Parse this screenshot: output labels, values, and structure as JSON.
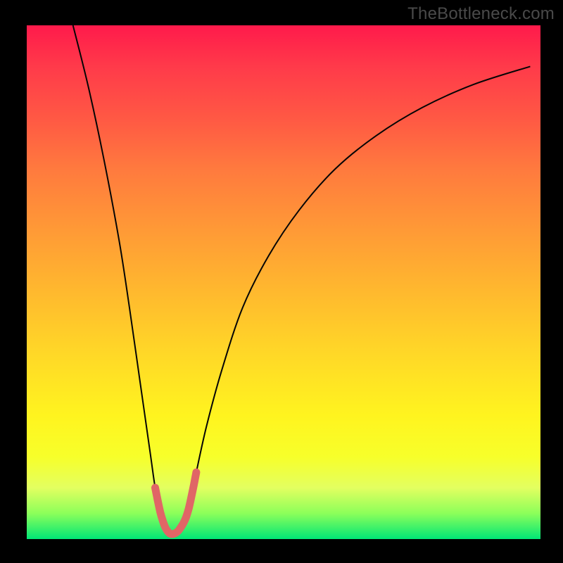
{
  "watermark": "TheBottleneck.com",
  "chart_data": {
    "type": "line",
    "title": "",
    "xlabel": "",
    "ylabel": "",
    "xlim": [
      0,
      100
    ],
    "ylim": [
      0,
      100
    ],
    "series": [
      {
        "name": "bottleneck-curve",
        "x": [
          9,
          12,
          15,
          18,
          20,
          22,
          24,
          25,
          26,
          27,
          28,
          29,
          30,
          31,
          32,
          33,
          35,
          38,
          42,
          47,
          53,
          60,
          68,
          77,
          87,
          98
        ],
        "values": [
          100,
          88,
          74,
          58,
          45,
          31,
          17,
          10,
          5,
          2,
          1,
          1,
          2,
          4,
          8,
          13,
          22,
          33,
          45,
          55,
          64,
          72,
          78.5,
          84,
          88.5,
          92
        ]
      },
      {
        "name": "highlight-band",
        "x": [
          25.0,
          25.5,
          26.0,
          26.5,
          27.0,
          27.5,
          28.0,
          28.5,
          29.0,
          29.5,
          30.0,
          30.5,
          31.0,
          31.5,
          32.0,
          32.5,
          33.0
        ],
        "values": [
          10.0,
          7.5,
          5.2,
          3.5,
          2.2,
          1.4,
          1.0,
          1.0,
          1.2,
          1.6,
          2.3,
          3.1,
          4.2,
          5.8,
          8.0,
          10.4,
          13.0
        ]
      }
    ],
    "colors": {
      "curve": "#050505",
      "highlight": "#e06666",
      "gradient_top": "#ff1a4b",
      "gradient_bottom": "#00e676"
    }
  }
}
